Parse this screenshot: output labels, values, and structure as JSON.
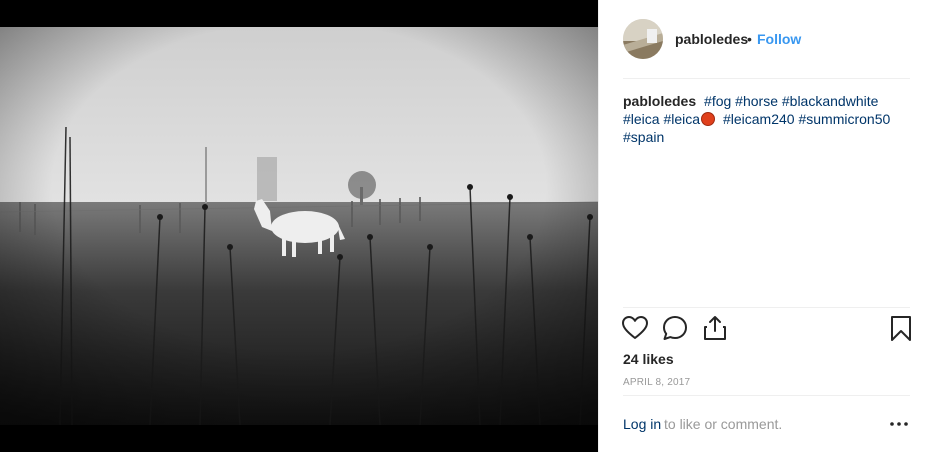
{
  "post": {
    "username": "pabloledes",
    "follow_label": "Follow",
    "separator": "•",
    "image_subject": "white horse standing in a foggy field"
  },
  "caption": {
    "username": "pabloledes",
    "tags": [
      "#fog",
      "#horse",
      "#blackandwhite",
      "#leica",
      "#leica",
      "#leicam240",
      "#summicron50",
      "#spain"
    ]
  },
  "actions": {
    "like_icon": "heart-icon",
    "comment_icon": "comment-icon",
    "share_icon": "share-icon",
    "save_icon": "bookmark-icon"
  },
  "stats": {
    "likes": "24 likes",
    "date": "APRIL 8, 2017"
  },
  "footer": {
    "login_label": "Log in",
    "login_rest": "to like or comment.",
    "more_label": "•••"
  },
  "colors": {
    "link_blue": "#3897f0",
    "hashtag": "#003569",
    "muted": "#999999",
    "red_dot": "#e0401c"
  }
}
